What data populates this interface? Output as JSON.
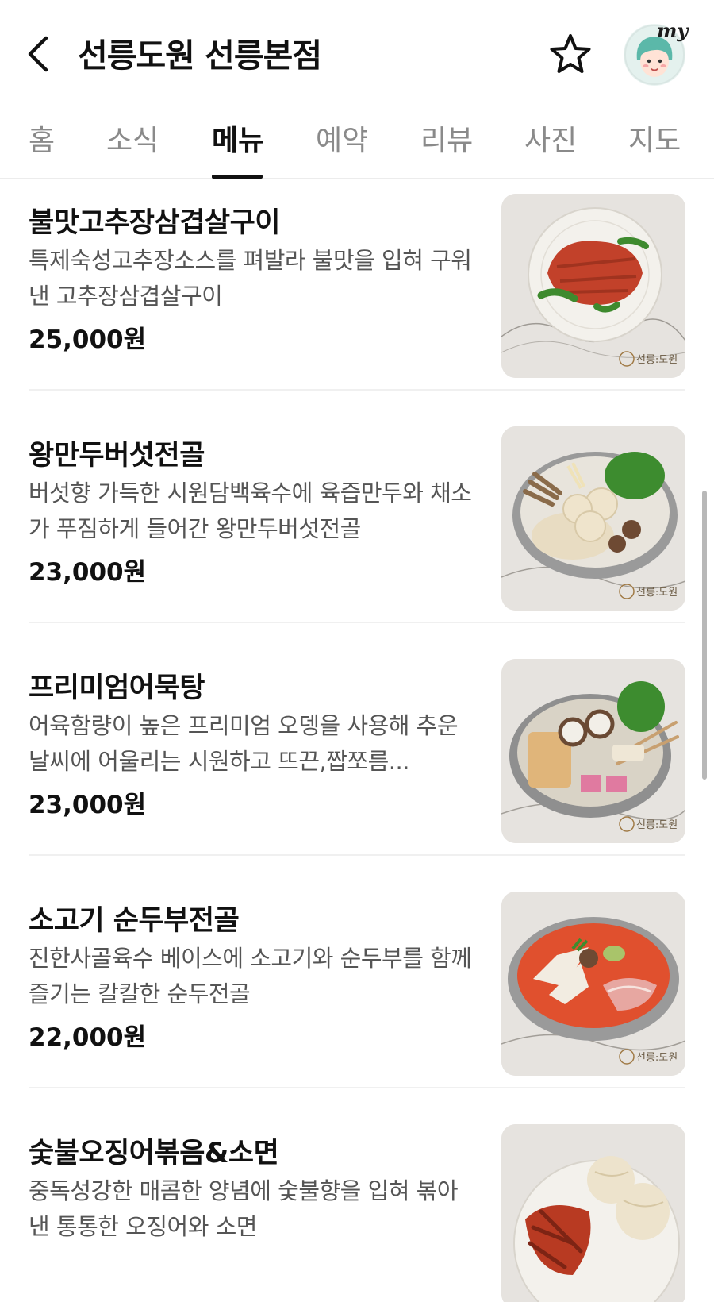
{
  "header": {
    "title": "선릉도원 선릉본점",
    "back_icon": "chevron-left-icon",
    "favorite_icon": "star-outline-icon",
    "avatar_badge": "my"
  },
  "tabs": [
    {
      "label": "홈",
      "active": false
    },
    {
      "label": "소식",
      "active": false
    },
    {
      "label": "메뉴",
      "active": true
    },
    {
      "label": "예약",
      "active": false
    },
    {
      "label": "리뷰",
      "active": false
    },
    {
      "label": "사진",
      "active": false
    },
    {
      "label": "지도",
      "active": false
    }
  ],
  "menu": [
    {
      "name": "불맛고추장삼겹살구이",
      "desc": "특제숙성고추장소스를 펴발라 불맛을 입혀 구워낸 고추장삼겹살구이",
      "price": "25,000원",
      "logo": "선릉:도원",
      "colors": {
        "plate": "#f3f1ec",
        "dish": "#c2412a",
        "accent": "#3e8a2e"
      }
    },
    {
      "name": "왕만두버섯전골",
      "desc": "버섯향 가득한 시원담백육수에 육즙만두와 채소가 푸짐하게 들어간 왕만두버섯전골",
      "price": "23,000원",
      "logo": "선릉:도원",
      "colors": {
        "plate": "#9a9a9a",
        "dish": "#e8dcc2",
        "accent": "#3d8c2f"
      }
    },
    {
      "name": "프리미엄어묵탕",
      "desc": "어육함량이 높은 프리미엄 오뎅을 사용해 추운날씨에 어울리는 시원하고 뜨끈,짭쪼름...",
      "price": "23,000원",
      "logo": "선릉:도원",
      "colors": {
        "plate": "#8f8f8f",
        "dish": "#e0b57a",
        "accent": "#3d8c2f"
      }
    },
    {
      "name": "소고기 순두부전골",
      "desc": "진한사골육수 베이스에 소고기와 순두부를 함께 즐기는 칼칼한 순두전골",
      "price": "22,000원",
      "logo": "선릉:도원",
      "colors": {
        "plate": "#9a9a9a",
        "dish": "#e0502e",
        "accent": "#f2ece1"
      }
    },
    {
      "name": "숯불오징어볶음&소면",
      "desc": "중독성강한 매콤한 양념에 숯불향을 입혀 볶아낸 통통한 오징어와 소면",
      "price": "",
      "logo": "",
      "colors": {
        "plate": "#f3f1ec",
        "dish": "#b83a22",
        "accent": "#ede3cc"
      }
    }
  ]
}
